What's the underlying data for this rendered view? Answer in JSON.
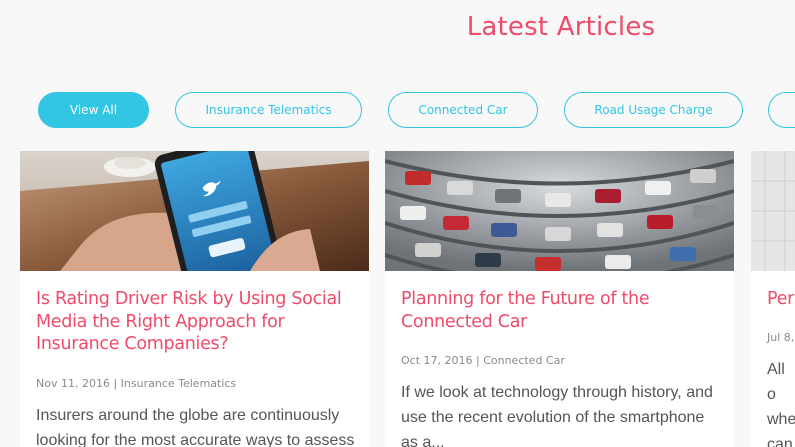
{
  "page": {
    "title": "Latest Articles"
  },
  "filters": [
    {
      "label": "View All",
      "active": true
    },
    {
      "label": "Insurance Telematics",
      "active": false
    },
    {
      "label": "Connected Car",
      "active": false
    },
    {
      "label": "Road Usage Charge",
      "active": false
    }
  ],
  "articles": [
    {
      "title": "Is Rating Driver Risk by Using Social Media the Right Approach for Insurance Companies?",
      "date": "Nov 11, 2016",
      "category": "Insurance Telematics",
      "excerpt": "Insurers around the globe are continuously looking for the most accurate ways to assess"
    },
    {
      "title": "Planning for the Future of the Connected Car",
      "date": "Oct 17, 2016",
      "category": "Connected Car",
      "excerpt": "If we look at technology through history, and use the recent evolution of the smartphone as a..."
    },
    {
      "title": "Pers",
      "date": "Jul 8,",
      "category": "",
      "excerpt": "All o whe can."
    }
  ],
  "colors": {
    "accent": "#ef4a6a",
    "chip": "#32c5e4"
  }
}
